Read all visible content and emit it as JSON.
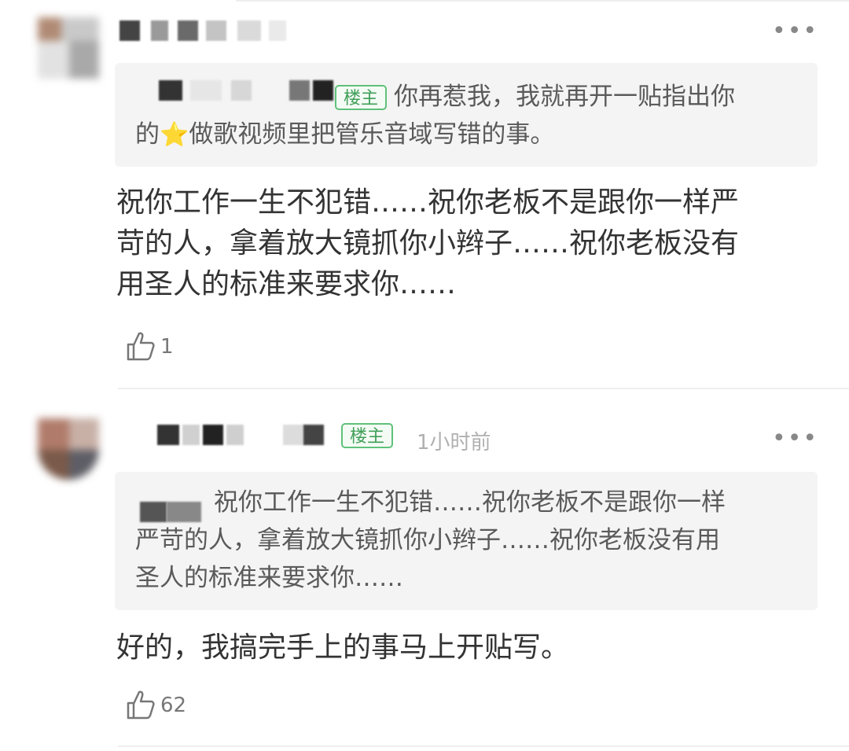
{
  "comments": [
    {
      "badge": "楼主",
      "quote": {
        "line1": "你再惹我，我就再开一贴指出你",
        "line2_pre": "的",
        "emoji": "⭐",
        "line2_post": "做歌视频里把管乐音域写错的事。"
      },
      "body_lines": [
        "祝你工作一生不犯错……祝你老板不是跟你一样严",
        "苛的人，拿着放大镜抓你小辫子……祝你老板没有",
        "用圣人的标准来要求你……"
      ],
      "likes": "1",
      "more": "•••"
    },
    {
      "badge": "楼主",
      "time": "1小时前",
      "quote": {
        "lines": [
          "祝你工作一生不犯错……祝你老板不是跟你一样",
          "严苛的人，拿着放大镜抓你小辫子……祝你老板没有用",
          "圣人的标准来要求你……"
        ]
      },
      "body_lines": [
        "好的，我搞完手上的事马上开贴写。"
      ],
      "likes": "62",
      "more": "•••"
    }
  ],
  "colors": {
    "badge_border": "#5fc17a",
    "badge_text": "#3f9f57",
    "quote_bg": "#f4f4f4",
    "body_text": "#333333",
    "muted": "#b0b0b0"
  },
  "icons": [
    "thumbs-up-icon",
    "more-icon",
    "star-emoji-icon"
  ]
}
